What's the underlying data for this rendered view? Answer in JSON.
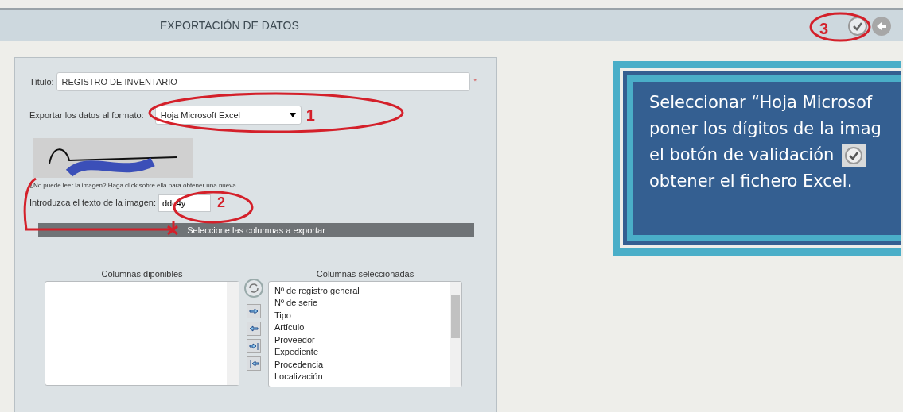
{
  "header": {
    "title": "EXPORTACIÓN DE DATOS",
    "annotation": "3"
  },
  "form": {
    "title_label": "Título:",
    "title_value": "REGISTRO DE INVENTARIO",
    "required_mark": "*",
    "format_label": "Exportar los datos al formato:",
    "format_value": "Hoja Microsoft Excel",
    "format_annotation": "1",
    "captcha_hint": "¿No puede leer la imagen? Haga click sobre ella para obtener una nueva.",
    "captcha_label": "Introduzca el texto de la imagen:",
    "captcha_value": "ddc4y",
    "captcha_annotation": "2"
  },
  "columns": {
    "heading": "Seleccione las columnas a exportar",
    "available_label": "Columnas diponibles",
    "selected_label": "Columnas seleccionadas",
    "selected": [
      "Nº de registro general",
      "Nº de serie",
      "Tipo",
      "Artículo",
      "Proveedor",
      "Expediente",
      "Procedencia",
      "Localización"
    ]
  },
  "callout": {
    "lines": [
      "Seleccionar “Hoja Microsof",
      "poner los dígitos de la imag",
      "el botón de validación",
      "obtener el fichero Excel."
    ]
  }
}
